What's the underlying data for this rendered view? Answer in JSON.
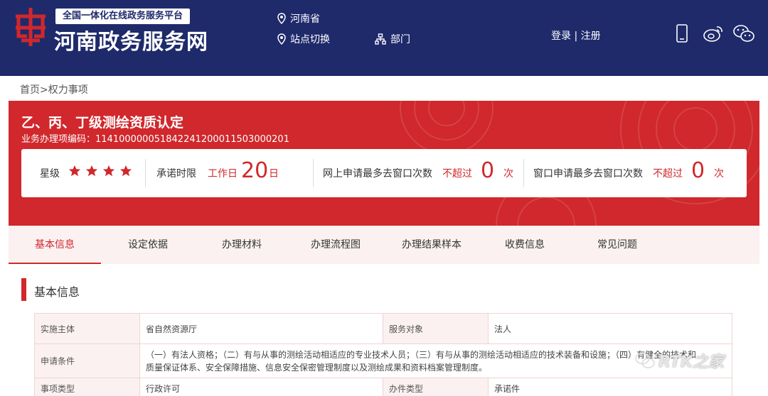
{
  "header": {
    "slogan": "全国一体化在线政务服务平台",
    "site_name": "河南政务服务网",
    "location": "河南省",
    "switch_site": "站点切换",
    "department": "部门",
    "login": "登录",
    "separator": "|",
    "register": "注册"
  },
  "breadcrumb": {
    "home": "首页",
    "sep": ">",
    "current": "权力事项"
  },
  "banner": {
    "title": "乙、丙、丁级测绘资质认定",
    "code_label": "业务办理项编码：",
    "code": "11410000005184224120001150300020​1"
  },
  "stats": {
    "rating_label": "星级",
    "rating": 4,
    "rating_max": 4,
    "deadline_label": "承诺时限",
    "deadline_unit_prefix": "工作日",
    "deadline_value": "20",
    "deadline_unit": "日",
    "online_label": "网上申请最多去窗口次数",
    "online_prefix": "不超过",
    "online_value": "0",
    "online_unit": "次",
    "window_label": "窗口申请最多去窗口次数",
    "window_prefix": "不超过",
    "window_value": "0",
    "window_unit": "次"
  },
  "tabs": [
    "基本信息",
    "设定依据",
    "办理材料",
    "办理流程图",
    "办理结果样本",
    "收费信息",
    "常见问题"
  ],
  "section": {
    "title": "基本信息"
  },
  "table": {
    "r1": {
      "l1": "实施主体",
      "v1": "省自然资源厅",
      "l2": "服务对象",
      "v2": "法人"
    },
    "r2": {
      "l1": "申请条件",
      "line1": "（一）有法人资格；（二）有与从事的测绘活动相适应的专业技术人员；（三）有与从事的测绘活动相适应的技术装备和设施；（四）有健全的技术和",
      "line2": "质量保证体系、安全保障措施、信息安全保密管理制度以及测绘成果和资料档案管理制度。"
    },
    "r3": {
      "l1": "事项类型",
      "v1": "行政许可",
      "l2": "办件类型",
      "v2": "承诺件"
    }
  },
  "watermark": "RTK之家",
  "colors": {
    "header_bg": "#1f2a6b",
    "accent": "#d0282c",
    "tab_bg": "#fbf1f1"
  }
}
